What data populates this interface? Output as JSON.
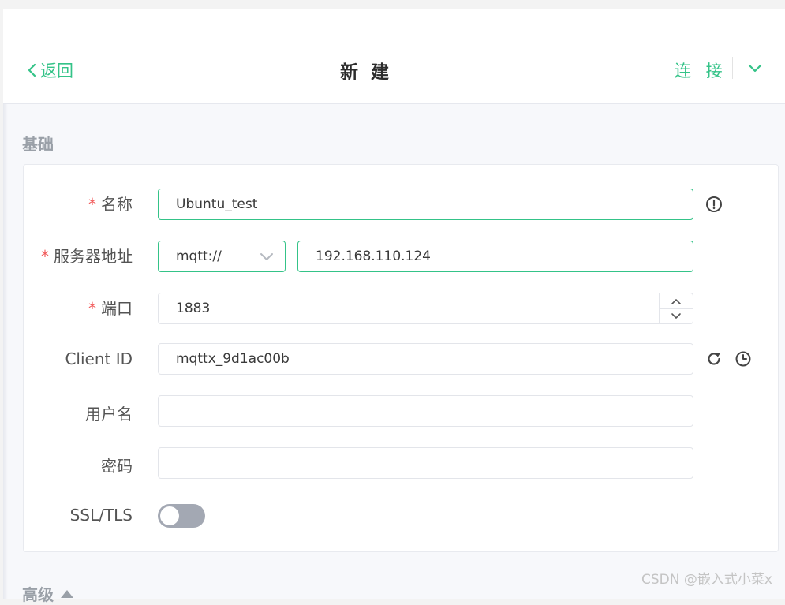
{
  "header": {
    "back_label": "返回",
    "title": "新 建",
    "connect_label": "连 接"
  },
  "sections": {
    "basic": "基础",
    "advanced": "高级"
  },
  "form": {
    "name": {
      "label": "名称",
      "required": "*",
      "value": "Ubuntu_test"
    },
    "host": {
      "label": "服务器地址",
      "required": "*",
      "protocol": "mqtt://",
      "value": "192.168.110.124"
    },
    "port": {
      "label": "端口",
      "required": "*",
      "value": "1883"
    },
    "client_id": {
      "label": "Client ID",
      "value": "mqttx_9d1ac00b"
    },
    "username": {
      "label": "用户名",
      "value": ""
    },
    "password": {
      "label": "密码",
      "value": ""
    },
    "ssl": {
      "label": "SSL/TLS",
      "enabled": false
    }
  },
  "icons": {
    "info": "exclamation-circle-icon",
    "refresh": "refresh-icon",
    "clock": "clock-icon"
  },
  "colors": {
    "accent": "#34c388",
    "required": "#f15a5a",
    "toggle_off": "#a3a8b3"
  },
  "watermark": "CSDN @嵌入式小菜x"
}
